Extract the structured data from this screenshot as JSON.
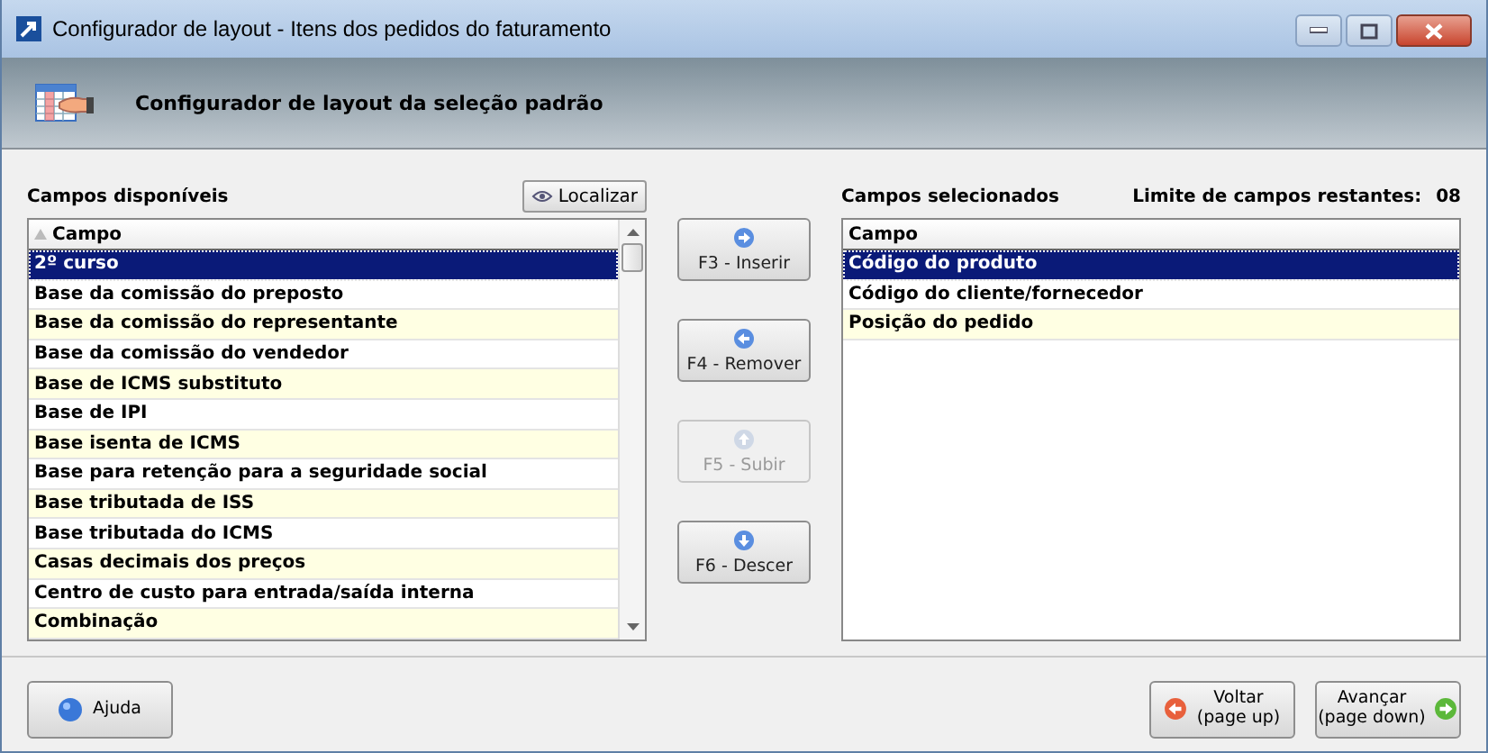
{
  "window": {
    "title": "Configurador de layout - Itens dos pedidos do faturamento"
  },
  "header": {
    "title": "Configurador de layout da seleção padrão"
  },
  "available": {
    "label": "Campos disponíveis",
    "find_button": "Localizar",
    "column": "Campo",
    "rows": [
      {
        "text": "2º curso",
        "selected": true
      },
      {
        "text": "Base da comissão do preposto",
        "selected": false
      },
      {
        "text": "Base da comissão do representante",
        "selected": false
      },
      {
        "text": "Base da comissão do vendedor",
        "selected": false
      },
      {
        "text": "Base de ICMS substituto",
        "selected": false
      },
      {
        "text": "Base de IPI",
        "selected": false
      },
      {
        "text": "Base isenta de ICMS",
        "selected": false
      },
      {
        "text": "Base para retenção para a seguridade social",
        "selected": false
      },
      {
        "text": "Base tributada de ISS",
        "selected": false
      },
      {
        "text": "Base tributada do ICMS",
        "selected": false
      },
      {
        "text": "Casas decimais dos preços",
        "selected": false
      },
      {
        "text": "Centro de custo para entrada/saída interna",
        "selected": false
      },
      {
        "text": "Combinação",
        "selected": false
      }
    ]
  },
  "actions": [
    {
      "label": "F3 - Inserir",
      "kind": "right",
      "disabled": false
    },
    {
      "label": "F4 - Remover",
      "kind": "left",
      "disabled": false
    },
    {
      "label": "F5 - Subir",
      "kind": "up",
      "disabled": true
    },
    {
      "label": "F6 - Descer",
      "kind": "down",
      "disabled": false
    }
  ],
  "selected_fields": {
    "label": "Campos selecionados",
    "limit_label": "Limite de campos restantes:",
    "limit_value": "08",
    "column": "Campo",
    "rows": [
      {
        "text": "Código do produto",
        "selected": true
      },
      {
        "text": "Código do cliente/fornecedor",
        "selected": false
      },
      {
        "text": "Posição do pedido",
        "selected": false
      }
    ]
  },
  "footer": {
    "help": "Ajuda",
    "back": [
      "Voltar",
      "(page up)"
    ],
    "next": [
      "Avançar",
      "(page down)"
    ]
  }
}
